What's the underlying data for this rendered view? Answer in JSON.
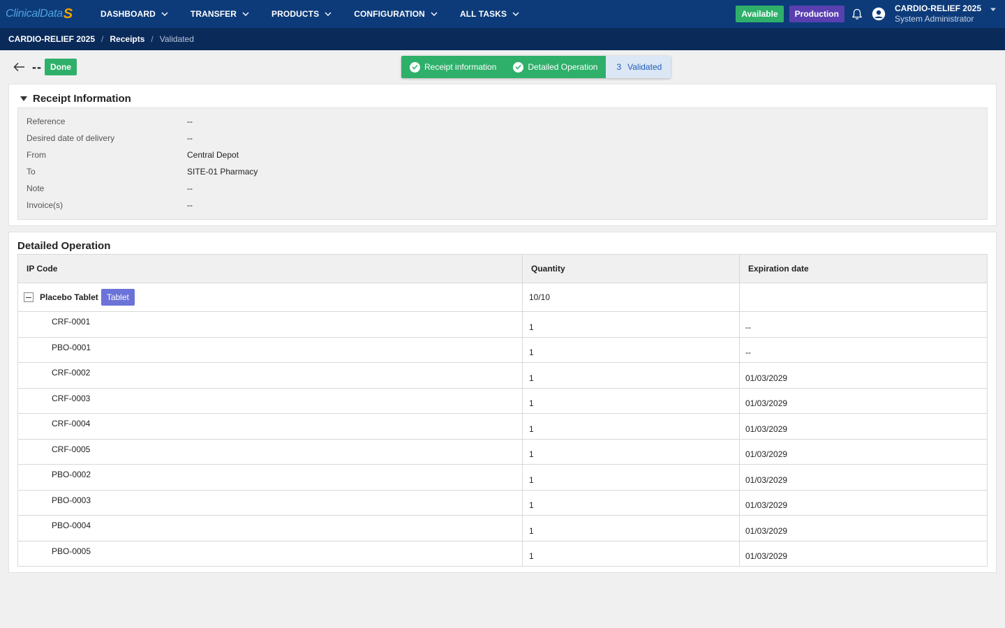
{
  "header": {
    "logo_text": "ClinicalData",
    "logo_mark": "S",
    "nav": [
      {
        "label": "DASHBOARD"
      },
      {
        "label": "TRANSFER"
      },
      {
        "label": "PRODUCTS"
      },
      {
        "label": "CONFIGURATION"
      },
      {
        "label": "ALL TASKS"
      }
    ],
    "status_available": "Available",
    "status_production": "Production",
    "user_study": "CARDIO-RELIEF 2025",
    "user_role": "System Administrator"
  },
  "breadcrumb": {
    "study": "CARDIO-RELIEF 2025",
    "section": "Receipts",
    "current": "Validated",
    "separator": "/"
  },
  "page": {
    "reference": "--",
    "status_badge": "Done",
    "steps": [
      {
        "label": "Receipt information",
        "state": "done"
      },
      {
        "label": "Detailed Operation",
        "state": "done"
      },
      {
        "number": "3",
        "label": "Validated",
        "state": "current"
      }
    ]
  },
  "receipt_info": {
    "title": "Receipt Information",
    "rows": [
      {
        "label": "Reference",
        "value": "--"
      },
      {
        "label": "Desired date of delivery",
        "value": "--"
      },
      {
        "label": "From",
        "value": "Central Depot"
      },
      {
        "label": "To",
        "value": "SITE-01 Pharmacy"
      },
      {
        "label": "Note",
        "value": "--"
      },
      {
        "label": "Invoice(s)",
        "value": "--"
      }
    ]
  },
  "detailed_operation": {
    "title": "Detailed Operation",
    "columns": [
      "IP Code",
      "Quantity",
      "Expiration date"
    ],
    "group": {
      "name": "Placebo Tablet",
      "badge": "Tablet",
      "quantity": "10/10",
      "expiration": ""
    },
    "items": [
      {
        "code": "CRF-0001",
        "quantity": "1",
        "expiration": "--"
      },
      {
        "code": "PBO-0001",
        "quantity": "1",
        "expiration": "--"
      },
      {
        "code": "CRF-0002",
        "quantity": "1",
        "expiration": "01/03/2029"
      },
      {
        "code": "CRF-0003",
        "quantity": "1",
        "expiration": "01/03/2029"
      },
      {
        "code": "CRF-0004",
        "quantity": "1",
        "expiration": "01/03/2029"
      },
      {
        "code": "CRF-0005",
        "quantity": "1",
        "expiration": "01/03/2029"
      },
      {
        "code": "PBO-0002",
        "quantity": "1",
        "expiration": "01/03/2029"
      },
      {
        "code": "PBO-0003",
        "quantity": "1",
        "expiration": "01/03/2029"
      },
      {
        "code": "PBO-0004",
        "quantity": "1",
        "expiration": "01/03/2029"
      },
      {
        "code": "PBO-0005",
        "quantity": "1",
        "expiration": "01/03/2029"
      }
    ]
  },
  "colors": {
    "nav_bg": "#0d3b7a",
    "breadcrumb_bg": "#0a2a5a",
    "success": "#2fb06a",
    "production": "#5a3fb0",
    "tablet_badge": "#6b73d9",
    "step_current": "#dbe7f5"
  },
  "icons": {
    "nav_chevron": "chevron-down-icon",
    "bell": "bell-icon",
    "avatar": "user-avatar-icon",
    "back": "arrow-left-icon",
    "check": "check-circle-icon",
    "collapse": "collapse-minus-icon",
    "section_toggle": "triangle-down-icon"
  }
}
